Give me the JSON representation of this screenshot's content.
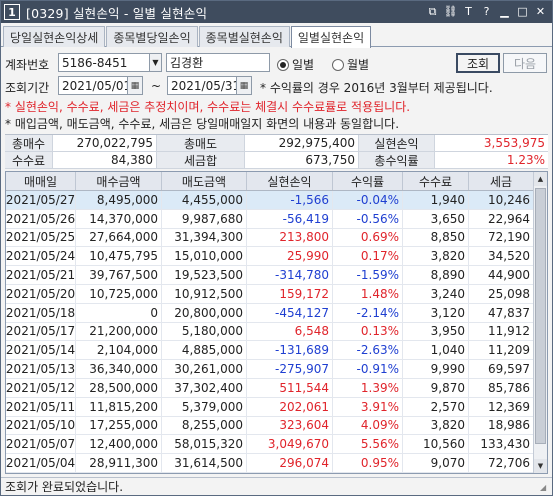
{
  "window": {
    "number": "1",
    "title": "[0329] 실현손익 - 일별 실현손익"
  },
  "tabs": [
    {
      "label": "당일실현손익상세",
      "active": false
    },
    {
      "label": "종목별당일손익",
      "active": false
    },
    {
      "label": "종목별실현손익",
      "active": false
    },
    {
      "label": "일별실현손익",
      "active": true
    }
  ],
  "form": {
    "account_label": "계좌번호",
    "account_value": "5186-8451",
    "owner_name": "김경환",
    "period_label": "조회기간",
    "date_from": "2021/05/01",
    "date_to": "2021/05/31",
    "tilde": "~",
    "radio_daily": "일별",
    "radio_monthly": "월별",
    "search_button": "조회",
    "next_button": "다음"
  },
  "notes": [
    {
      "text": "* 수익률의 경우 2016년 3월부터 제공됩니다.",
      "color": "black"
    },
    {
      "text": "* 실현손익, 수수료, 세금은 추정치이며, 수수료는 체결시 수수료률로 적용됩니다.",
      "color": "red"
    },
    {
      "text": "* 매입금액, 매도금액, 수수료, 세금은 당일매매일지 화면의 내용과 동일합니다.",
      "color": "black"
    }
  ],
  "summary": {
    "total_buy_label": "총매수",
    "total_buy": "270,022,795",
    "total_sell_label": "총매도",
    "total_sell": "292,975,400",
    "realized_label": "실현손익",
    "realized": "3,553,975",
    "fee_label": "수수료",
    "fee": "84,380",
    "tax_total_label": "세금합",
    "tax_total": "673,750",
    "total_return_label": "총수익률",
    "total_return": "1.23%"
  },
  "table": {
    "columns": [
      "매매일",
      "매수금액",
      "매도금액",
      "실현손익",
      "수익률",
      "수수료",
      "세금"
    ],
    "rows": [
      {
        "date": "2021/05/27",
        "buy": "8,495,000",
        "sell": "4,455,000",
        "pnl": "-1,566",
        "rate": "-0.04%",
        "fee": "1,940",
        "tax": "10,246",
        "sign": "neg"
      },
      {
        "date": "2021/05/26",
        "buy": "14,370,000",
        "sell": "9,987,680",
        "pnl": "-56,419",
        "rate": "-0.56%",
        "fee": "3,650",
        "tax": "22,964",
        "sign": "neg"
      },
      {
        "date": "2021/05/25",
        "buy": "27,664,000",
        "sell": "31,394,300",
        "pnl": "213,800",
        "rate": "0.69%",
        "fee": "8,850",
        "tax": "72,190",
        "sign": "pos"
      },
      {
        "date": "2021/05/24",
        "buy": "10,475,795",
        "sell": "15,010,000",
        "pnl": "25,990",
        "rate": "0.17%",
        "fee": "3,820",
        "tax": "34,520",
        "sign": "pos"
      },
      {
        "date": "2021/05/21",
        "buy": "39,767,500",
        "sell": "19,523,500",
        "pnl": "-314,780",
        "rate": "-1.59%",
        "fee": "8,890",
        "tax": "44,900",
        "sign": "neg"
      },
      {
        "date": "2021/05/20",
        "buy": "10,725,000",
        "sell": "10,912,500",
        "pnl": "159,172",
        "rate": "1.48%",
        "fee": "3,240",
        "tax": "25,098",
        "sign": "pos"
      },
      {
        "date": "2021/05/18",
        "buy": "0",
        "sell": "20,800,000",
        "pnl": "-454,127",
        "rate": "-2.14%",
        "fee": "3,120",
        "tax": "47,837",
        "sign": "neg"
      },
      {
        "date": "2021/05/17",
        "buy": "21,200,000",
        "sell": "5,180,000",
        "pnl": "6,548",
        "rate": "0.13%",
        "fee": "3,950",
        "tax": "11,912",
        "sign": "pos"
      },
      {
        "date": "2021/05/14",
        "buy": "2,104,000",
        "sell": "4,885,000",
        "pnl": "-131,689",
        "rate": "-2.63%",
        "fee": "1,040",
        "tax": "11,209",
        "sign": "neg"
      },
      {
        "date": "2021/05/13",
        "buy": "36,340,000",
        "sell": "30,261,000",
        "pnl": "-275,907",
        "rate": "-0.91%",
        "fee": "9,990",
        "tax": "69,597",
        "sign": "neg"
      },
      {
        "date": "2021/05/12",
        "buy": "28,500,000",
        "sell": "37,302,400",
        "pnl": "511,544",
        "rate": "1.39%",
        "fee": "9,870",
        "tax": "85,786",
        "sign": "pos"
      },
      {
        "date": "2021/05/11",
        "buy": "11,815,200",
        "sell": "5,379,000",
        "pnl": "202,061",
        "rate": "3.91%",
        "fee": "2,570",
        "tax": "12,369",
        "sign": "pos"
      },
      {
        "date": "2021/05/10",
        "buy": "17,255,000",
        "sell": "8,255,000",
        "pnl": "323,604",
        "rate": "4.09%",
        "fee": "3,820",
        "tax": "18,986",
        "sign": "pos"
      },
      {
        "date": "2021/05/07",
        "buy": "12,400,000",
        "sell": "58,015,320",
        "pnl": "3,049,670",
        "rate": "5.56%",
        "fee": "10,560",
        "tax": "133,430",
        "sign": "pos"
      },
      {
        "date": "2021/05/04",
        "buy": "28,911,300",
        "sell": "31,614,500",
        "pnl": "296,074",
        "rate": "0.95%",
        "fee": "9,070",
        "tax": "72,706",
        "sign": "pos"
      }
    ]
  },
  "status": {
    "text": "조회가 완료되었습니다."
  },
  "colors": {
    "positive": "#e0242b",
    "negative": "#1f3fd1",
    "selected_row": "#dbeaf7",
    "titlebar": "#3f4c5e"
  },
  "icons": [
    "window-number-icon",
    "restore-icon",
    "link-icon",
    "font-icon",
    "help-icon",
    "minimize-icon",
    "maximize-icon",
    "close-icon",
    "calendar-icon",
    "chevron-down-icon",
    "scroll-up-icon",
    "scroll-down-icon"
  ]
}
